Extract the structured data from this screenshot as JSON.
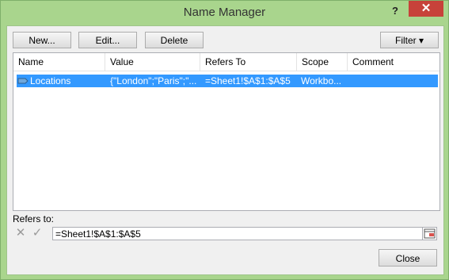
{
  "window": {
    "title": "Name Manager",
    "help_label": "?",
    "close_label": "✕"
  },
  "toolbar": {
    "new_label": "New...",
    "edit_label": "Edit...",
    "delete_label": "Delete",
    "filter_label": "Filter ▾"
  },
  "list": {
    "columns": [
      "Name",
      "Value",
      "Refers To",
      "Scope",
      "Comment"
    ],
    "rows": [
      {
        "name": "Locations",
        "value": "{\"London\";\"Paris\";\"...",
        "refers_to": "=Sheet1!$A$1:$A$5",
        "scope": "Workbo...",
        "comment": ""
      }
    ]
  },
  "refers": {
    "label": "Refers to:",
    "value": "=Sheet1!$A$1:$A$5",
    "cancel_icon": "✕",
    "confirm_icon": "✓"
  },
  "footer": {
    "close_label": "Close"
  },
  "colors": {
    "frame": "#a9d58d",
    "selection": "#3399ff",
    "close_button": "#c7423a"
  },
  "icons": [
    "name-tag-icon",
    "collapse-range-icon",
    "cancel-edit-icon",
    "confirm-edit-icon"
  ]
}
